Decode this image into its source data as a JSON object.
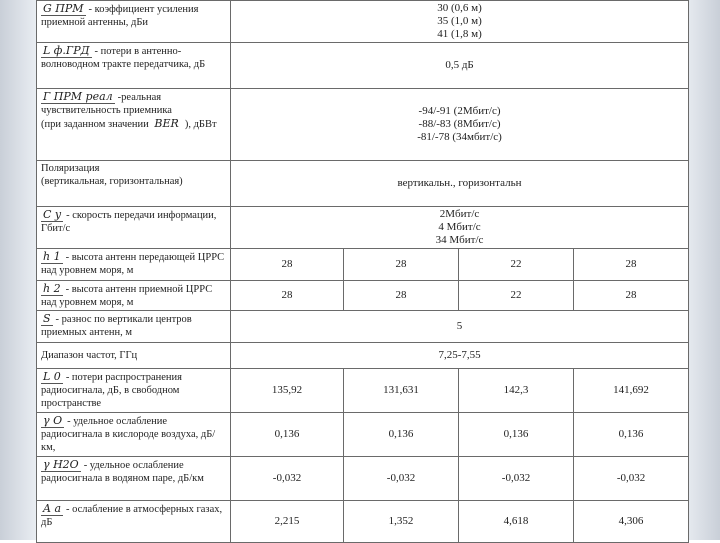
{
  "rows": [
    {
      "symbol": "G ПРМ",
      "text": "- коэффициент усиления приемной антенны, дБи",
      "values": [
        "30 (0,6 м)",
        "35 (1,0 м)",
        "41 (1,8 м)"
      ]
    },
    {
      "symbol": "L ф.ГРД",
      "text": "- потери в антенно-волноводном тракте передатчика, дБ",
      "values": [
        "0,5 дБ"
      ]
    },
    {
      "symbol": "Г ПРМ реал",
      "text_lines": [
        "-реальная",
        "чувствительность приемника",
        "(при заданном значении",
        "), дБВт"
      ],
      "inline_symbol": "BER",
      "values": [
        "-94/-91 (2Мбит/с)",
        "-88/-83 (8Мбит/с)",
        "-81/-78 (34мбит/с)"
      ]
    },
    {
      "text_lines": [
        "Поляризация",
        "(вертикальная, горизонтальная)"
      ],
      "values": [
        "вертикальн., горизонтальн"
      ]
    },
    {
      "symbol": "C y",
      "text": "- скорость передачи информации, Гбит/с",
      "values": [
        "2Мбит/с",
        "4 Мбит/с",
        "34 Мбит/с"
      ]
    },
    {
      "symbol": "h 1",
      "text": "- высота антенн передающей ЦРРС над уровнем моря, м",
      "values": [
        "28",
        "28",
        "22",
        "28"
      ]
    },
    {
      "symbol": "h 2",
      "text": "- высота антенн приемной ЦРРС над уровнем моря, м",
      "values": [
        "28",
        "28",
        "22",
        "28"
      ]
    },
    {
      "symbol": "S",
      "text": "- разнос по вертикали центров приемных антенн, м",
      "values": [
        "5"
      ]
    },
    {
      "text": "Диапазон частот, ГГц",
      "values": [
        "7,25-7,55"
      ]
    },
    {
      "symbol": "L 0",
      "text": "- потери распространения радиосигнала, дБ, в свободном пространстве",
      "values": [
        "135,92",
        "131,631",
        "142,3",
        "141,692"
      ]
    },
    {
      "symbol": "γ O",
      "text": "- удельное ослабление радиосигнала в кислороде воздуха, дБ/км,",
      "values": [
        "0,136",
        "0,136",
        "0,136",
        "0,136"
      ]
    },
    {
      "symbol": "γ H2O",
      "text": "- удельное ослабление радиосигнала в водяном паре, дБ/км",
      "values": [
        "-0,032",
        "-0,032",
        "-0,032",
        "-0,032"
      ]
    },
    {
      "symbol": "A a",
      "text": "- ослабление в атмосферных газах, дБ",
      "values": [
        "2,215",
        "1,352",
        "4,618",
        "4,306"
      ]
    }
  ]
}
